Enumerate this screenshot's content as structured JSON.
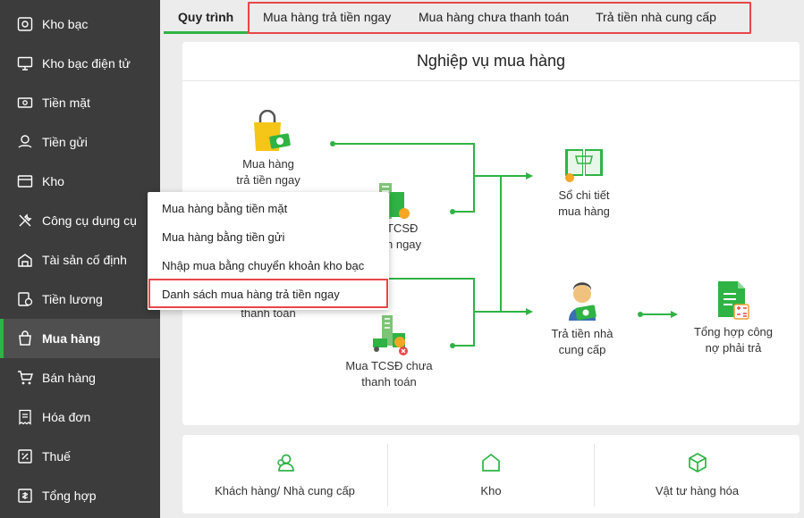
{
  "sidebar": {
    "items": [
      {
        "label": "Kho bạc",
        "icon": "bank-icon"
      },
      {
        "label": "Kho bạc điện tử",
        "icon": "monitor-bank-icon"
      },
      {
        "label": "Tiền mặt",
        "icon": "cash-icon"
      },
      {
        "label": "Tiền gửi",
        "icon": "deposit-icon"
      },
      {
        "label": "Kho",
        "icon": "warehouse-icon"
      },
      {
        "label": "Công cụ dụng cụ",
        "icon": "tools-icon"
      },
      {
        "label": "Tài sản cố định",
        "icon": "fixed-asset-icon"
      },
      {
        "label": "Tiền lương",
        "icon": "salary-icon"
      },
      {
        "label": "Mua hàng",
        "icon": "shopping-bag-icon"
      },
      {
        "label": "Bán hàng",
        "icon": "cart-icon"
      },
      {
        "label": "Hóa đơn",
        "icon": "invoice-icon"
      },
      {
        "label": "Thuế",
        "icon": "tax-icon"
      },
      {
        "label": "Tổng hợp",
        "icon": "summary-icon"
      }
    ],
    "active_index": 8,
    "accent": "#2fb344"
  },
  "tabs": [
    {
      "label": "Quy trình"
    },
    {
      "label": "Mua hàng trả tiền ngay"
    },
    {
      "label": "Mua hàng chưa thanh toán"
    },
    {
      "label": "Trả tiền nhà cung cấp"
    }
  ],
  "panel": {
    "title": "Nghiệp vụ mua hàng",
    "nodes": {
      "buy_pay_now_1": "Mua hàng",
      "buy_pay_now_2": "trả tiền ngay",
      "tcsd_now_1": "TCSĐ",
      "tcsd_now_2": "n ngay",
      "unpaid_partial": "thanh toán",
      "tcsd_unpaid_1": "Mua TCSĐ chưa",
      "tcsd_unpaid_2": "thanh toán",
      "ledger_1": "Sổ chi tiết",
      "ledger_2": "mua hàng",
      "pay_supplier_1": "Trả tiền nhà",
      "pay_supplier_2": "cung cấp",
      "payable_1": "Tổng hợp công",
      "payable_2": "nợ phải trả"
    }
  },
  "dropdown": {
    "items": [
      "Mua hàng bằng tiền mặt",
      "Mua hàng bằng tiền gửi",
      "Nhập mua bằng chuyển khoản kho bạc",
      "Danh sách mua hàng trả tiền ngay"
    ]
  },
  "bottom": {
    "items": [
      {
        "label": "Khách hàng/ Nhà cung cấp",
        "icon": "customers-icon"
      },
      {
        "label": "Kho",
        "icon": "warehouse-outline-icon"
      },
      {
        "label": "Vật tư hàng hóa",
        "icon": "box-icon"
      }
    ]
  }
}
